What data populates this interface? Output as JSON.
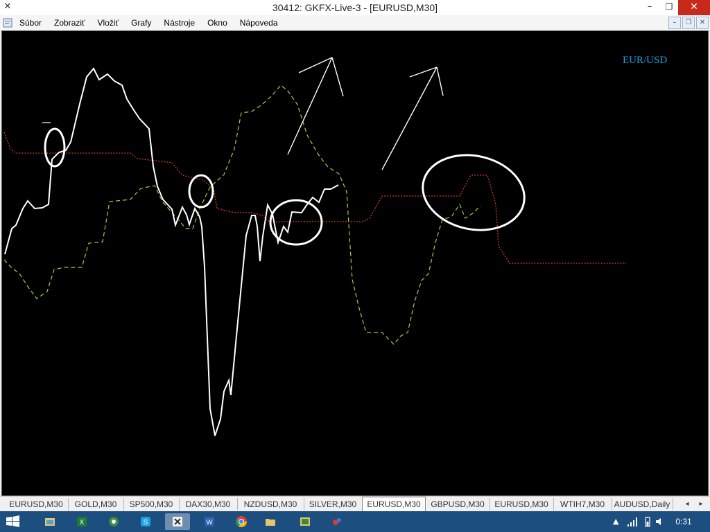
{
  "window": {
    "title": "30412: GKFX-Live-3 - [EURUSD,M30]",
    "app_icon": "metatrader-icon",
    "controls": {
      "minimize": "–",
      "maximize": "❐",
      "close": "✕"
    }
  },
  "menubar": {
    "items": [
      "Súbor",
      "Zobraziť",
      "Vložiť",
      "Grafy",
      "Nástroje",
      "Okno",
      "Nápoveda"
    ],
    "mdi_controls": {
      "minimize": "–",
      "restore": "❐",
      "close": "✕"
    }
  },
  "chart": {
    "symbol_label": "EUR/USD",
    "colors": {
      "background": "#000000",
      "price_line": "#ffffff",
      "green_dashed": "#9bd43f",
      "red_dotted": "#d23a2a",
      "annotation": "#ffffff",
      "label": "#1aa3e8"
    },
    "overlay_icon": "drawing-annotations"
  },
  "tabs": {
    "items": [
      "EURUSD,M30",
      "GOLD,M30",
      "SP500,M30",
      "DAX30,M30",
      "NZDUSD,M30",
      "SILVER,M30",
      "EURUSD,M30",
      "GBPUSD,M30",
      "EURUSD,M30",
      "WTIH7,M30",
      "AUDUSD,Daily"
    ],
    "active_index": 6,
    "scroll_left": "◂",
    "scroll_right": "▸"
  },
  "taskbar": {
    "apps": [
      "file-explorer-icon",
      "excel-icon",
      "xbox-icon",
      "skype-icon",
      "metatrader-icon",
      "word-icon",
      "chrome-icon",
      "folder-icon",
      "photos-icon",
      "app-icon"
    ],
    "active_index": 4,
    "clock": "0:31",
    "tray": [
      "chevron-up-icon",
      "signal-icon",
      "battery-icon",
      "speaker-icon"
    ]
  }
}
